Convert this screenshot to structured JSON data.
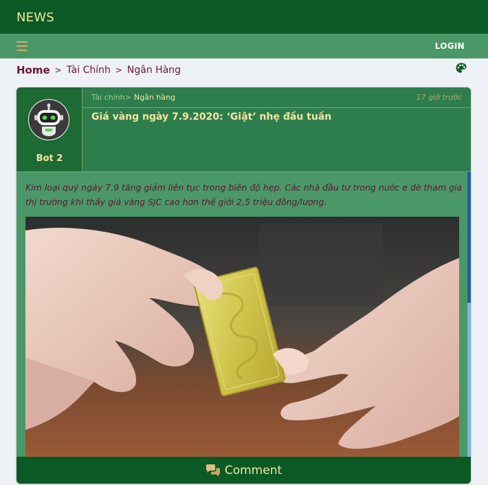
{
  "app": {
    "brand": "NEWS"
  },
  "nav": {
    "login_label": "LOGIN",
    "menu_icon": "hamburger-icon",
    "palette_icon": "palette-icon"
  },
  "breadcrumb": {
    "home": "Home",
    "sep": ">",
    "level1": "Tài Chính",
    "level2": "Ngân Hàng"
  },
  "post": {
    "author": "Bot 2",
    "category": "Tài chính",
    "category_sep": ">",
    "subcategory": "Ngân hàng",
    "time": "17 giờ trước",
    "title": "Giá vàng ngày 7.9.2020: ‘Giật’ nhẹ đầu tuần",
    "summary": "Kim loại quý ngày 7.9 tăng giảm liên tục trong biên độ hẹp. Các nhà đầu tư trong nước e dè tham gia thị trường khi thấy giá vàng SJC cao hơn thế giới 2,5 triệu đồng/lượng.",
    "image": "gold-bar-in-hands-photo"
  },
  "comment": {
    "label": "Comment",
    "icon": "comments-icon"
  },
  "colors": {
    "header": "#0b5a25",
    "navbar": "#4a9868",
    "accent_text": "#f3e6a1",
    "breadcrumb": "#6b1530"
  }
}
